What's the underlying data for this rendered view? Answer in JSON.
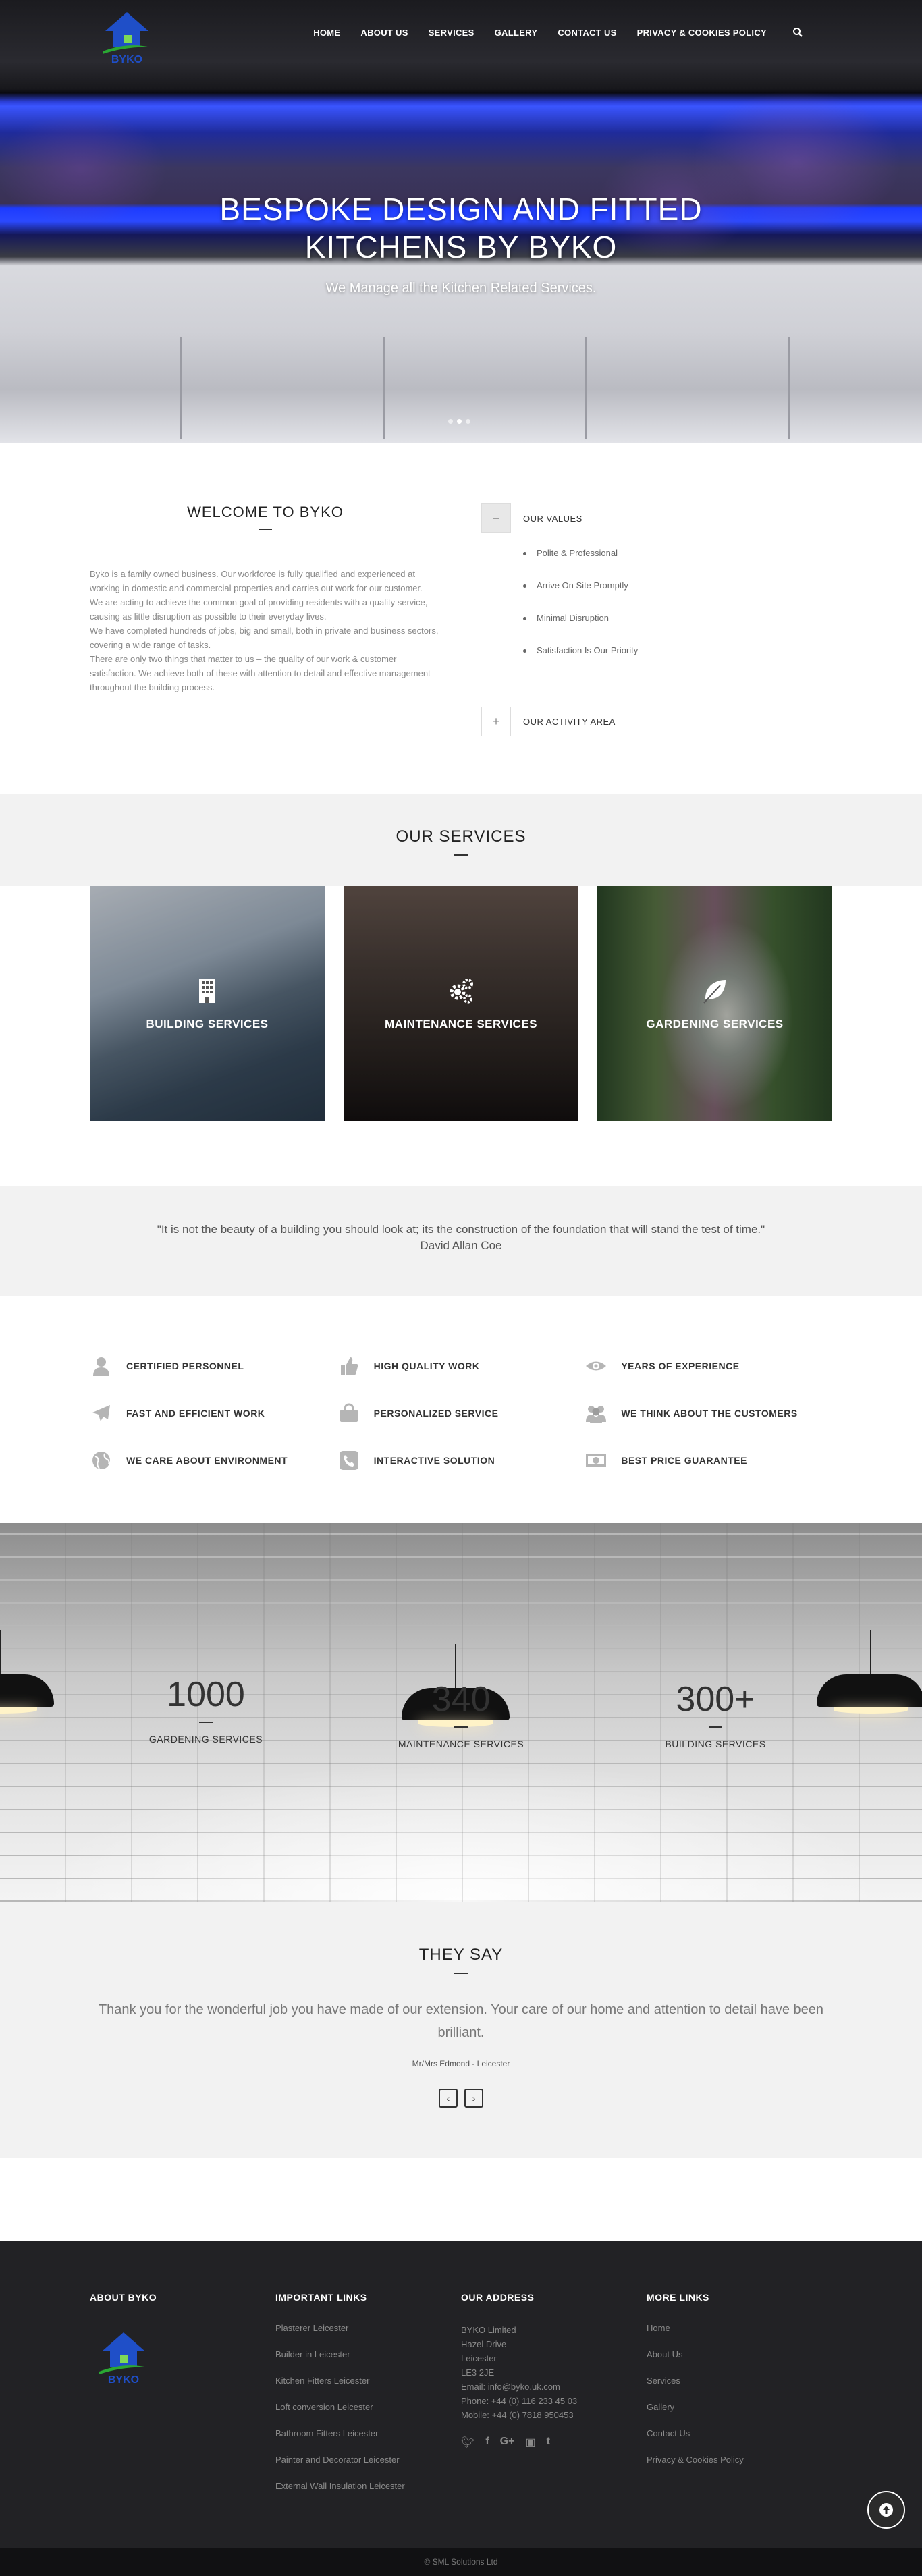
{
  "nav": {
    "logo_text": "BYKO",
    "items": [
      "HOME",
      "ABOUT US",
      "SERVICES",
      "GALLERY",
      "CONTACT US",
      "PRIVACY & COOKIES POLICY"
    ]
  },
  "hero": {
    "title_line1": "BESPOKE DESIGN AND FITTED",
    "title_line2": "KITCHENS BY BYKO",
    "subtitle": "We Manage all the Kitchen Related Services."
  },
  "welcome": {
    "title": "WELCOME TO BYKO",
    "paragraphs": [
      "Byko is a family owned business. Our workforce is fully qualified and experienced at working in domestic and commercial properties and carries out work for our customer.",
      "We are acting to achieve the common goal of providing residents with a quality service, causing as little disruption as possible to their everyday lives.",
      "We have completed hundreds of jobs, big and small, both in private and business sectors, covering a wide range of tasks.",
      "There are only two things that matter to us – the quality of our work & customer satisfaction. We achieve both of these with attention to detail and effective management throughout the building process."
    ],
    "values_title": "OUR VALUES",
    "values_toggle": "−",
    "values": [
      "Polite & Professional",
      "Arrive On Site Promptly",
      "Minimal Disruption",
      "Satisfaction Is Our Priority"
    ],
    "activity_title": "OUR ACTIVITY AREA",
    "activity_toggle": "+"
  },
  "services": {
    "title": "OUR SERVICES",
    "cards": [
      "BUILDING SERVICES",
      "MAINTENANCE SERVICES",
      "GARDENING SERVICES"
    ]
  },
  "quote": {
    "text": "\"It is not the beauty of a building you should look at; its the construction of the foundation that will stand the test of time.\"",
    "author": "David Allan Coe"
  },
  "features": [
    "CERTIFIED PERSONNEL",
    "HIGH QUALITY WORK",
    "YEARS OF EXPERIENCE",
    "FAST AND EFFICIENT WORK",
    "PERSONALIZED SERVICE",
    "WE THINK ABOUT THE CUSTOMERS",
    "WE CARE ABOUT ENVIRONMENT",
    "INTERACTIVE SOLUTION",
    "BEST PRICE GUARANTEE"
  ],
  "counters": [
    {
      "num": "1000",
      "label": "GARDENING SERVICES"
    },
    {
      "num": "340",
      "label": "MAINTENANCE SERVICES"
    },
    {
      "num": "300+",
      "label": "BUILDING SERVICES"
    }
  ],
  "testimonials": {
    "title": "THEY SAY",
    "text": "Thank you for the wonderful job you have made of our extension. Your care of our home and attention to detail have been brilliant.",
    "who": "Mr/Mrs Edmond - Leicester",
    "prev": "‹",
    "next": "›"
  },
  "footer": {
    "about_title": "ABOUT BYKO",
    "links_title": "IMPORTANT LINKS",
    "links": [
      "Plasterer Leicester",
      "Builder in Leicester",
      "Kitchen Fitters Leicester",
      "Loft conversion Leicester",
      "Bathroom Fitters Leicester",
      "Painter and Decorator Leicester",
      "External Wall Insulation Leicester"
    ],
    "address_title": "OUR ADDRESS",
    "address": [
      "BYKO Limited",
      "Hazel Drive",
      "Leicester",
      "LE3 2JE",
      "Email: info@byko.uk.com",
      "Phone: +44 (0) 116 233 45 03",
      "Mobile: +44 (0) 7818 950453"
    ],
    "social": [
      "twitter-icon",
      "facebook-icon",
      "google-plus-icon",
      "instagram-icon",
      "tumblr-icon"
    ],
    "more_title": "MORE LINKS",
    "more": [
      "Home",
      "About Us",
      "Services",
      "Gallery",
      "Contact Us",
      "Privacy & Cookies Policy"
    ],
    "copyright": "© SML Solutions Ltd"
  },
  "colors": {
    "accent_blue": "#1f4fc8",
    "accent_green": "#2aa833",
    "footer_bg": "#222225"
  }
}
